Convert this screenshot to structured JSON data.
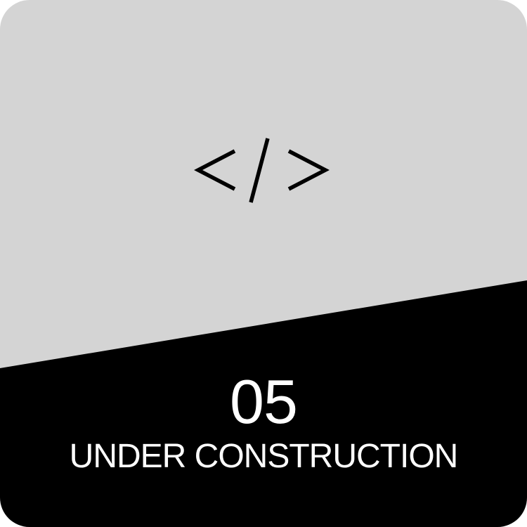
{
  "tile": {
    "number": "05",
    "label": "UNDER CONSTRUCTION",
    "icon": "code-icon",
    "colors": {
      "top_background": "#d4d4d4",
      "bottom_band": "#000000",
      "text": "#ffffff",
      "icon_stroke": "#000000"
    }
  }
}
